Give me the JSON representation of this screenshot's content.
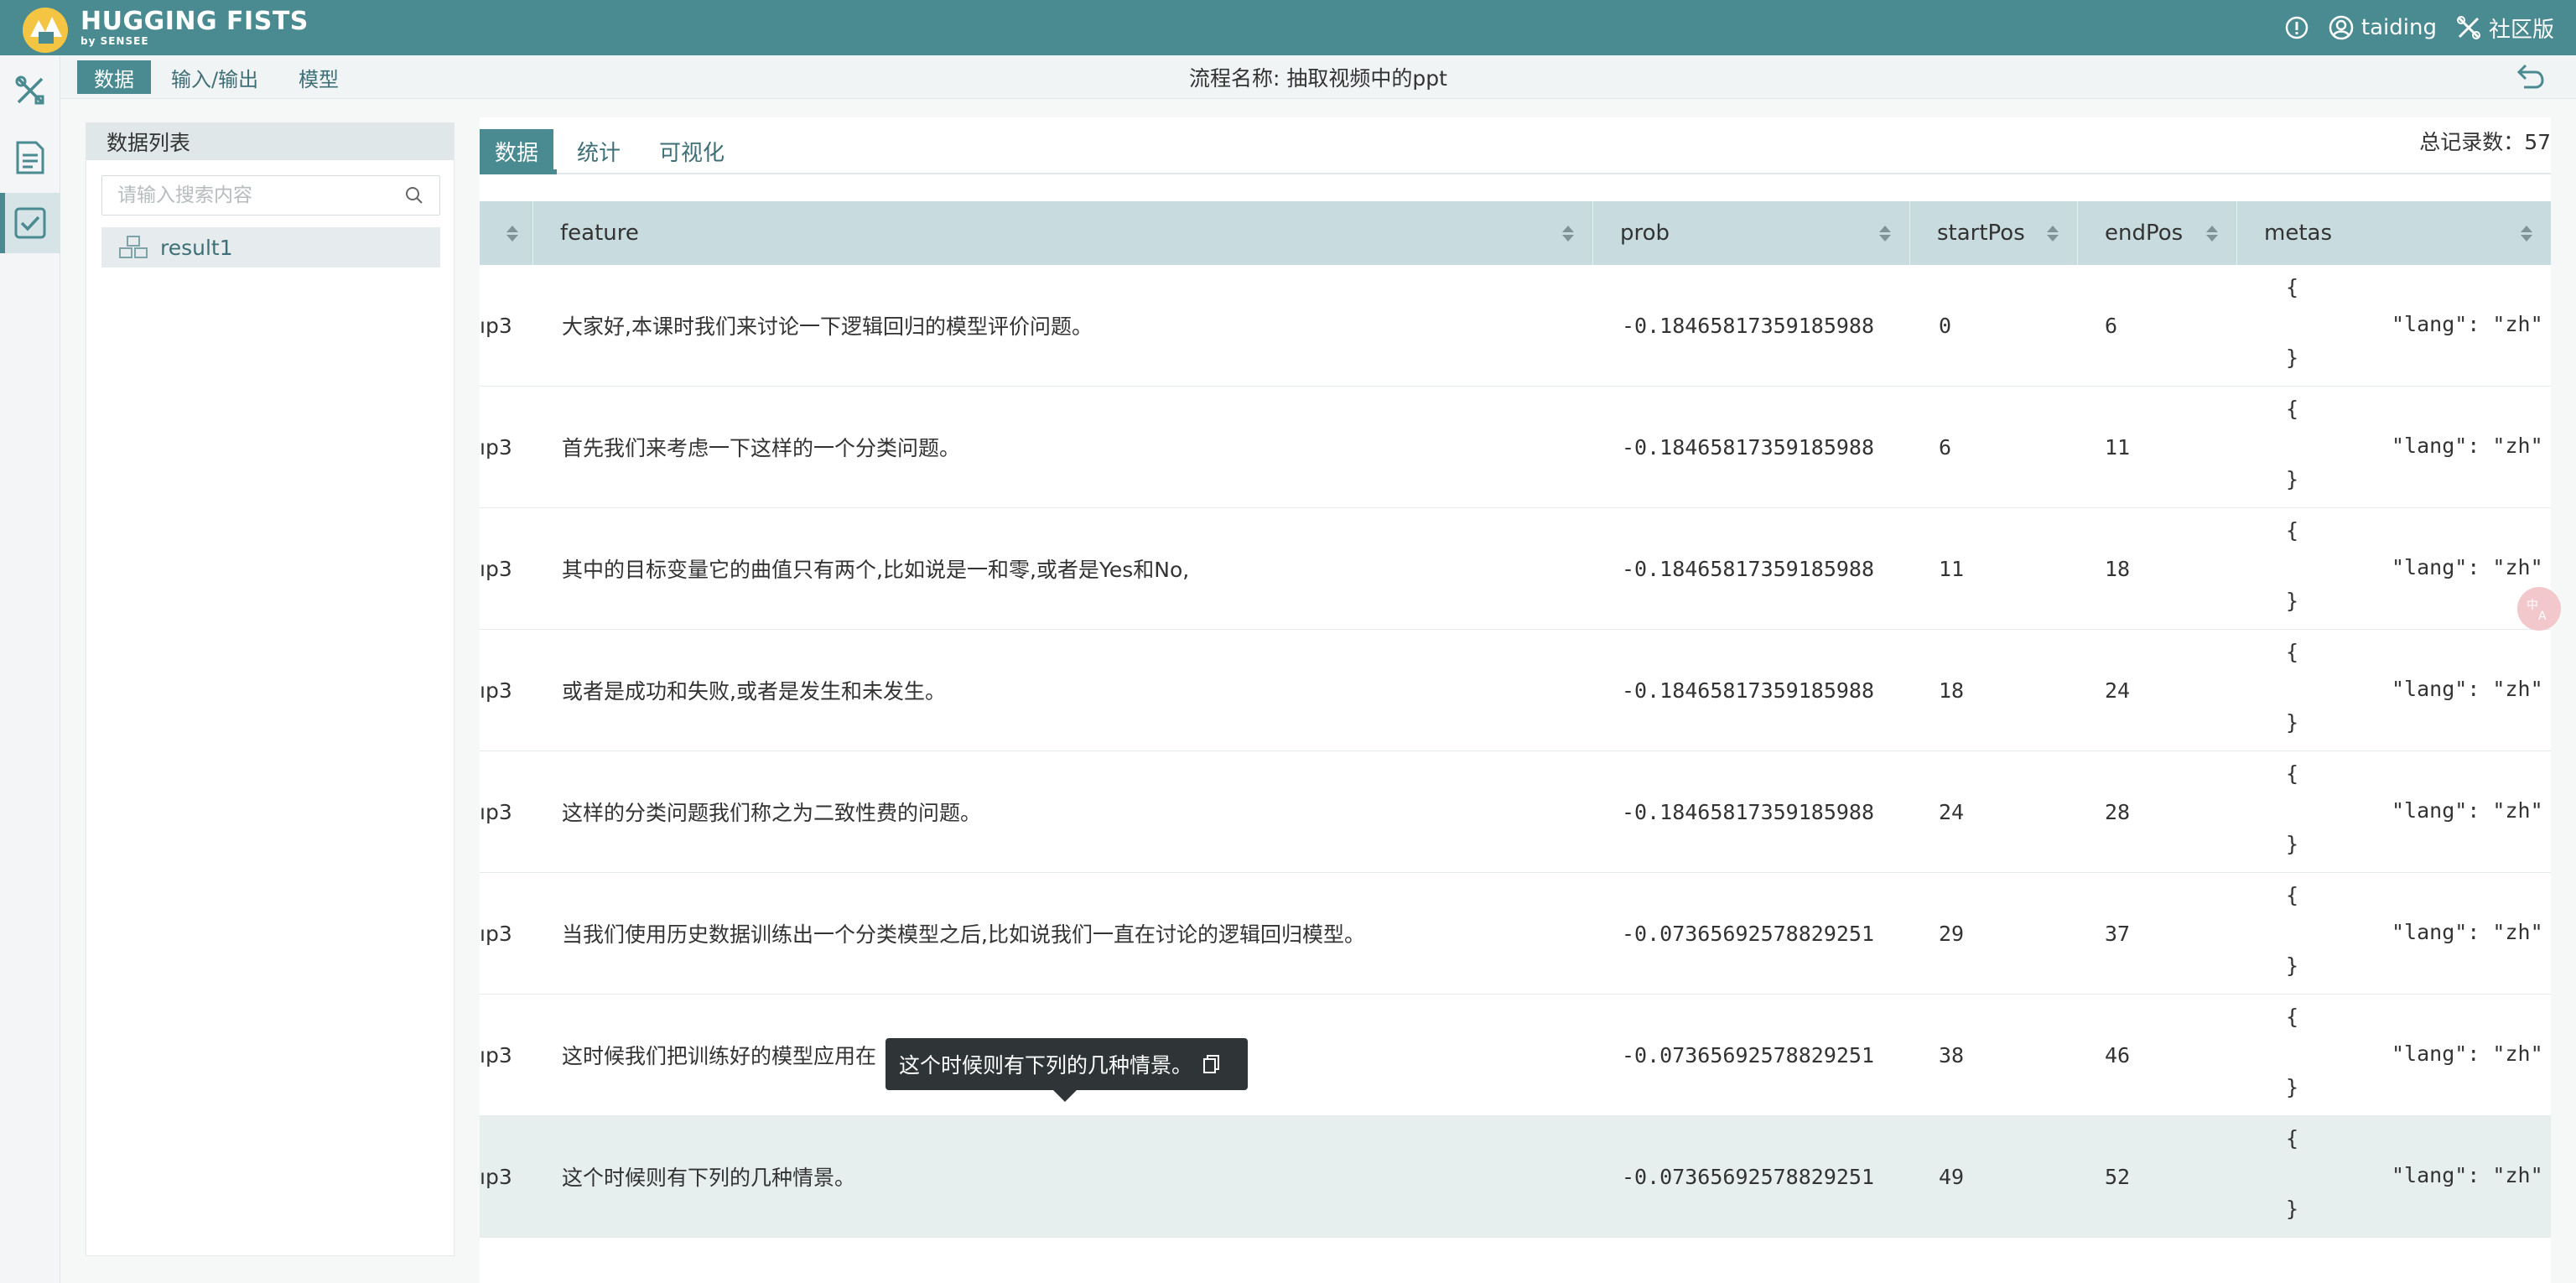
{
  "app": {
    "brand": "HUGGING FISTS",
    "brand_sub": "by SENSEE",
    "user": "taiding",
    "edition": "社区版"
  },
  "subnav": {
    "tabs": [
      "数据",
      "输入/输出",
      "模型"
    ],
    "active": 0,
    "flow_title": "流程名称: 抽取视频中的ppt"
  },
  "sidebar": {
    "title": "数据列表",
    "search_placeholder": "请输入搜索内容",
    "items": [
      "result1"
    ]
  },
  "main": {
    "tabs": [
      "数据",
      "统计",
      "可视化"
    ],
    "active_tab": 0,
    "total_records": "总记录数：57"
  },
  "table": {
    "columns": [
      "feature",
      "prob",
      "startPos",
      "endPos",
      "metas"
    ],
    "first_col_fragment": "ıp3",
    "rows": [
      {
        "c0": "ıp3",
        "feature": "大家好,本课时我们来讨论一下逻辑回归的模型评价问题。",
        "prob": "-0.18465817359185988",
        "startPos": "0",
        "endPos": "6",
        "metas_open": "{",
        "metas_kv": "\"lang\": \"zh\"",
        "metas_close": "}"
      },
      {
        "c0": "ıp3",
        "feature": "首先我们来考虑一下这样的一个分类问题。",
        "prob": "-0.18465817359185988",
        "startPos": "6",
        "endPos": "11",
        "metas_open": "{",
        "metas_kv": "\"lang\": \"zh\"",
        "metas_close": "}"
      },
      {
        "c0": "ıp3",
        "feature": "其中的目标变量它的曲值只有两个,比如说是一和零,或者是Yes和No,",
        "prob": "-0.18465817359185988",
        "startPos": "11",
        "endPos": "18",
        "metas_open": "{",
        "metas_kv": "\"lang\": \"zh\"",
        "metas_close": "}"
      },
      {
        "c0": "ıp3",
        "feature": "或者是成功和失败,或者是发生和未发生。",
        "prob": "-0.18465817359185988",
        "startPos": "18",
        "endPos": "24",
        "metas_open": "{",
        "metas_kv": "\"lang\": \"zh\"",
        "metas_close": "}"
      },
      {
        "c0": "ıp3",
        "feature": "这样的分类问题我们称之为二致性费的问题。",
        "prob": "-0.18465817359185988",
        "startPos": "24",
        "endPos": "28",
        "metas_open": "{",
        "metas_kv": "\"lang\": \"zh\"",
        "metas_close": "}"
      },
      {
        "c0": "ıp3",
        "feature": "当我们使用历史数据训练出一个分类模型之后,比如说我们一直在讨论的逻辑回归模型。",
        "prob": "-0.07365692578829251",
        "startPos": "29",
        "endPos": "37",
        "metas_open": "{",
        "metas_kv": "\"lang\": \"zh\"",
        "metas_close": "}"
      },
      {
        "c0": "ıp3",
        "feature": "这时候我们把训练好的模型应用在",
        "prob": "-0.07365692578829251",
        "startPos": "38",
        "endPos": "46",
        "metas_open": "{",
        "metas_kv": "\"lang\": \"zh\"",
        "metas_close": "}"
      },
      {
        "c0": "ıp3",
        "feature": "这个时候则有下列的几种情景。",
        "prob": "-0.07365692578829251",
        "startPos": "49",
        "endPos": "52",
        "metas_open": "{",
        "metas_kv": "\"lang\": \"zh\"",
        "metas_close": "}"
      }
    ]
  },
  "tooltip": {
    "text": "这个时候则有下列的几种情景。"
  },
  "colors": {
    "primary": "#4a8a91",
    "header_row": "#c8dbde"
  }
}
